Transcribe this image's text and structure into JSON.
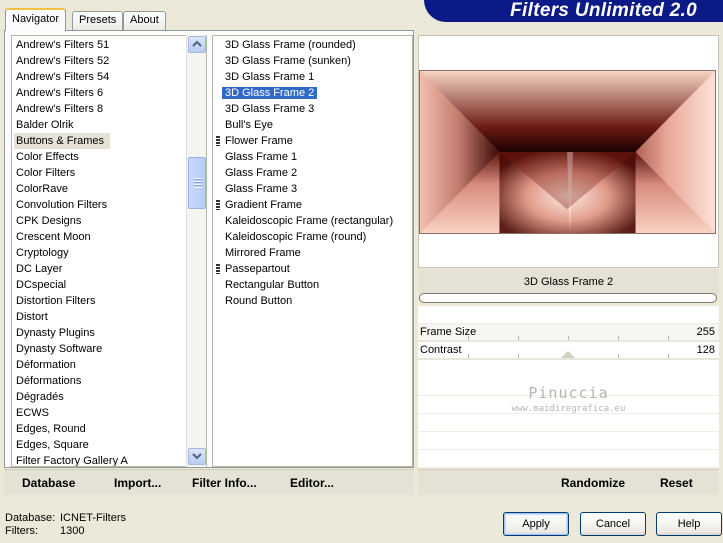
{
  "banner": {
    "title": "Filters Unlimited 2.0"
  },
  "tabs": [
    {
      "label": "Navigator",
      "active": true
    },
    {
      "label": "Presets",
      "active": false
    },
    {
      "label": "About",
      "active": false
    }
  ],
  "categories": {
    "selected": "Buttons & Frames",
    "items": [
      "Andrew's Filters 51",
      "Andrew's Filters 52",
      "Andrew's Filters 54",
      "Andrew's Filters 6",
      "Andrew's Filters 8",
      "Balder Olrik",
      "Buttons & Frames",
      "Color Effects",
      "Color Filters",
      "ColorRave",
      "Convolution Filters",
      "CPK Designs",
      "Crescent Moon",
      "Cryptology",
      "DC Layer",
      "DCspecial",
      "Distortion Filters",
      "Distort",
      "Dynasty Plugins",
      "Dynasty Software",
      "Déformation",
      "Déformations",
      "Dégradés",
      "ECWS",
      "Edges, Round",
      "Edges, Square",
      "Filter Factory Gallery A"
    ]
  },
  "filters": {
    "selected": "3D Glass Frame 2",
    "items": [
      {
        "label": "3D Glass Frame (rounded)",
        "marked": false
      },
      {
        "label": "3D Glass Frame (sunken)",
        "marked": false
      },
      {
        "label": "3D Glass Frame 1",
        "marked": false
      },
      {
        "label": "3D Glass Frame 2",
        "marked": false
      },
      {
        "label": "3D Glass Frame 3",
        "marked": false
      },
      {
        "label": "Bull's Eye",
        "marked": false
      },
      {
        "label": "Flower Frame",
        "marked": true
      },
      {
        "label": "Glass Frame 1",
        "marked": false
      },
      {
        "label": "Glass Frame 2",
        "marked": false
      },
      {
        "label": "Glass Frame 3",
        "marked": false
      },
      {
        "label": "Gradient Frame",
        "marked": true
      },
      {
        "label": "Kaleidoscopic Frame (rectangular)",
        "marked": false
      },
      {
        "label": "Kaleidoscopic Frame (round)",
        "marked": false
      },
      {
        "label": "Mirrored Frame",
        "marked": false
      },
      {
        "label": "Passepartout",
        "marked": true
      },
      {
        "label": "Rectangular Button",
        "marked": false
      },
      {
        "label": "Round Button",
        "marked": false
      }
    ]
  },
  "strip": {
    "database": "Database",
    "import": "Import...",
    "filter_info": "Filter Info...",
    "editor": "Editor...",
    "randomize": "Randomize",
    "reset": "Reset"
  },
  "preview": {
    "filter_name": "3D Glass Frame 2"
  },
  "params": [
    {
      "label": "Frame Size",
      "value": "255",
      "fraction": 1.0
    },
    {
      "label": "Contrast",
      "value": "128",
      "fraction": 0.5
    }
  ],
  "watermark": {
    "name": "Pinuccia",
    "site": "www.maidiregrafica.eu"
  },
  "status": {
    "database_label": "Database:",
    "database_value": "ICNET-Filters",
    "filters_label": "Filters:",
    "filters_value": "1300"
  },
  "buttons": {
    "apply": "Apply",
    "cancel": "Cancel",
    "help": "Help"
  },
  "colors": {
    "banner": "#0b1a86",
    "selection": "#316ac5",
    "frame_light": "#f6c8b6",
    "frame_dark": "#1a0000"
  }
}
